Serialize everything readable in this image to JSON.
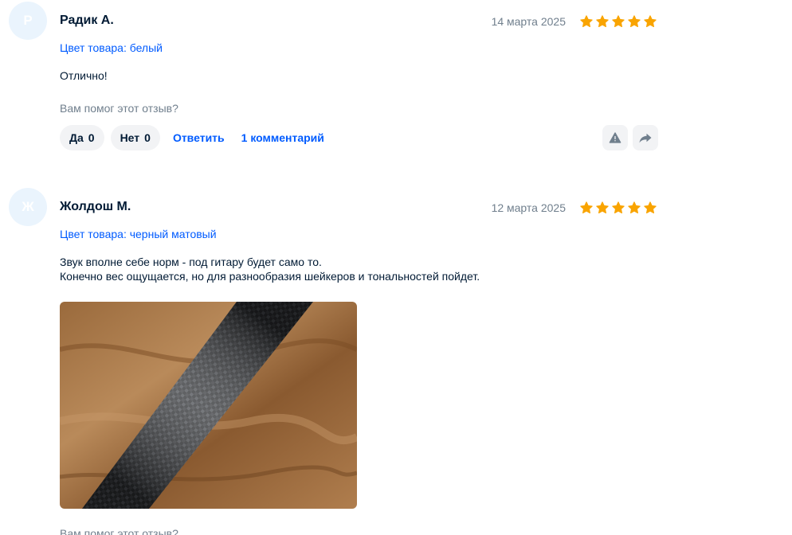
{
  "colors": {
    "accent": "#005bff",
    "star": "#f9a400",
    "muted": "#707f8d",
    "pill_bg": "#f2f3f5",
    "avatar_bg": "#eaf4fd"
  },
  "reviews": [
    {
      "avatar_initial": "Р",
      "author": "Радик А.",
      "date": "14 марта 2025",
      "rating": 5,
      "variant": "Цвет товара: белый",
      "text_lines": [
        "Отлично!"
      ],
      "helpful_question": "Вам помог этот отзыв?",
      "yes_label": "Да",
      "yes_count": "0",
      "no_label": "Нет",
      "no_count": "0",
      "reply_label": "Ответить",
      "comments_label": "1 комментарий",
      "report_icon": "warning-icon",
      "share_icon": "share-icon"
    },
    {
      "avatar_initial": "Ж",
      "author": "Жолдош М.",
      "date": "12 марта 2025",
      "rating": 5,
      "variant": "Цвет товара: черный матовый",
      "text_lines": [
        "Звук вполне себе норм - под гитару будет само то.",
        "Конечно вес ощущается, но для разнообразия шейкеров и тональностей пойдет."
      ],
      "photo_icon": "carbon-fiber-shaker-photo",
      "helpful_question": "Вам помог этот отзыв?"
    }
  ]
}
